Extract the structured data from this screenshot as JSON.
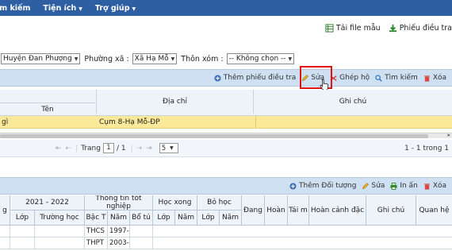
{
  "menu": [
    {
      "label": "ìm kiếm",
      "caret": ""
    },
    {
      "label": "Tiện ích",
      "caret": "▼"
    },
    {
      "label": "Trợ giúp",
      "caret": "▼"
    }
  ],
  "downloads": {
    "template": "Tải file mẫu",
    "form": "Phiếu điều tra"
  },
  "filters": {
    "district": "Huyện Đan Phượng",
    "commune_label": "Phường xã :",
    "commune": "Xã Hạ Mỗ",
    "hamlet_label": "Thôn xóm :",
    "hamlet": "-- Không chọn --"
  },
  "toolbar1": {
    "add": "Thêm phiếu điều tra",
    "edit": "Sửa",
    "merge": "Ghép hộ",
    "search": "Tìm kiếm",
    "delete": "Xóa"
  },
  "grid1": {
    "headers": {
      "name": "Tên",
      "address": "Địa chỉ",
      "note": "Ghi chú"
    },
    "row": {
      "name": "gì",
      "address": "Cụm 8-Hạ Mỗ-ĐP",
      "note": ""
    }
  },
  "pager": {
    "first": "⇤",
    "prev": "⇠",
    "page_label": "Trang",
    "page": "1",
    "of": "/ 1",
    "next": "⇢",
    "last": "⇥",
    "size": "5",
    "summary": "1 - 1 trong 1"
  },
  "toolbar2": {
    "add": "Thêm Đối tượng",
    "edit": "Sửa",
    "print": "In ấn",
    "delete": "Xóa"
  },
  "grid2": {
    "group_headers": {
      "g": "g",
      "year": "2021 - 2022",
      "grad": "Thông tin tốt nghiệp",
      "done": "Học xong",
      "drop": "Bỏ học",
      "dang": "Đang",
      "hoan": "Hoàn",
      "tai": "Tái m",
      "situation": "Hoàn cảnh đặc",
      "note": "Ghi chú",
      "rel": "Quan hệ"
    },
    "sub_headers": {
      "lop1": "Lớp",
      "school": "Trường học",
      "bac": "Bậc T",
      "nam1": "Năm",
      "bo": "Bổ tú",
      "lop2": "Lớp",
      "nam2": "Năm",
      "lop3": "Lớp",
      "nam3": "Năm"
    },
    "rows": [
      {
        "bac": "THCS",
        "nam": "1997-1"
      },
      {
        "bac": "THPT",
        "nam": "2003-2"
      }
    ]
  },
  "colors": {
    "menu": "#2f5fa3",
    "panel": "#cfe0f3",
    "selected_row": "#fbe99a",
    "highlight": "#e01212"
  }
}
